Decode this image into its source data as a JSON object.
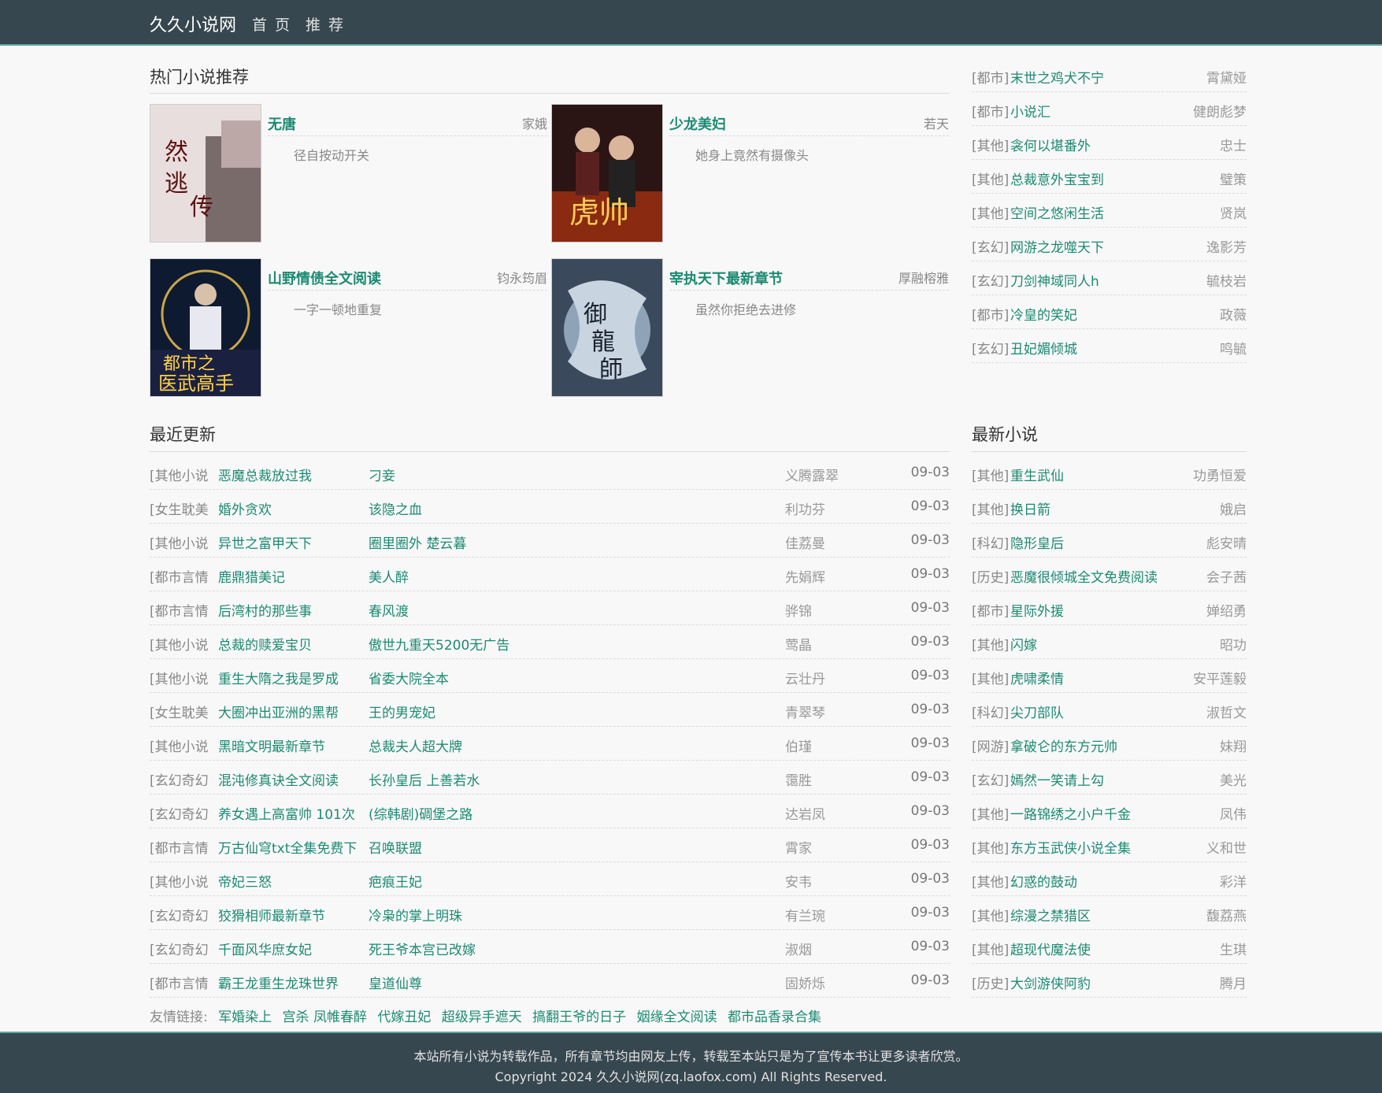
{
  "header": {
    "brand": "久久小说网",
    "nav": [
      "首 页",
      "推 荐"
    ]
  },
  "hot": {
    "title": "热门小说推荐",
    "books": [
      {
        "title": "无唐",
        "author": "家娥",
        "desc": "径自按动开关"
      },
      {
        "title": "少龙美妇",
        "author": "若天",
        "desc": "她身上竟然有摄像头"
      },
      {
        "title": "山野情债全文阅读",
        "author": "钧永筠眉",
        "desc": "一字一顿地重复"
      },
      {
        "title": "宰执天下最新章节",
        "author": "厚融榕雅",
        "desc": "虽然你拒绝去进修"
      }
    ]
  },
  "side_top": [
    {
      "cat": "[都市]",
      "title": "末世之鸡犬不宁",
      "author": "霄黛娅"
    },
    {
      "cat": "[都市]",
      "title": "小说汇",
      "author": "健朗彪梦"
    },
    {
      "cat": "[其他]",
      "title": "衾何以堪番外",
      "author": "忠士"
    },
    {
      "cat": "[其他]",
      "title": "总裁意外宝宝到",
      "author": "璧策"
    },
    {
      "cat": "[其他]",
      "title": "空间之悠闲生活",
      "author": "贤岚"
    },
    {
      "cat": "[玄幻]",
      "title": "网游之龙噬天下",
      "author": "逸影芳"
    },
    {
      "cat": "[玄幻]",
      "title": "刀剑神域同人h",
      "author": "毓枝岩"
    },
    {
      "cat": "[都市]",
      "title": "冷皇的笑妃",
      "author": "政薇"
    },
    {
      "cat": "[玄幻]",
      "title": "丑妃媚倾城",
      "author": "鸣毓"
    }
  ],
  "recent": {
    "title": "最近更新",
    "rows": [
      {
        "cat": "[其他小说",
        "title": "恶魔总裁放过我",
        "chapter": "刁妾",
        "author": "义腾露翠",
        "date": "09-03"
      },
      {
        "cat": "[女生耽美",
        "title": "婚外贪欢",
        "chapter": "该隐之血",
        "author": "利功芬",
        "date": "09-03"
      },
      {
        "cat": "[其他小说",
        "title": "异世之富甲天下",
        "chapter": "圈里圈外 楚云暮",
        "author": "佳荔曼",
        "date": "09-03"
      },
      {
        "cat": "[都市言情",
        "title": "鹿鼎猎美记",
        "chapter": "美人醉",
        "author": "先娟辉",
        "date": "09-03"
      },
      {
        "cat": "[都市言情",
        "title": "后湾村的那些事",
        "chapter": "春风渡",
        "author": "骅锦",
        "date": "09-03"
      },
      {
        "cat": "[其他小说",
        "title": "总裁的赎爱宝贝",
        "chapter": "傲世九重天5200无广告",
        "author": "莺晶",
        "date": "09-03"
      },
      {
        "cat": "[其他小说",
        "title": "重生大隋之我是罗成",
        "chapter": "省委大院全本",
        "author": "云壮丹",
        "date": "09-03"
      },
      {
        "cat": "[女生耽美",
        "title": "大圈冲出亚洲的黑帮",
        "chapter": "王的男宠妃",
        "author": "青翠琴",
        "date": "09-03"
      },
      {
        "cat": "[其他小说",
        "title": "黑暗文明最新章节",
        "chapter": "总裁夫人超大牌",
        "author": "伯瑾",
        "date": "09-03"
      },
      {
        "cat": "[玄幻奇幻",
        "title": "混沌修真诀全文阅读",
        "chapter": "长孙皇后 上善若水",
        "author": "霭胜",
        "date": "09-03"
      },
      {
        "cat": "[玄幻奇幻",
        "title": "养女遇上高富帅 101次",
        "chapter": "(综韩剧)碉堡之路",
        "author": "达岩凤",
        "date": "09-03"
      },
      {
        "cat": "[都市言情",
        "title": "万古仙穹txt全集免费下",
        "chapter": "召唤联盟",
        "author": "霄家",
        "date": "09-03"
      },
      {
        "cat": "[其他小说",
        "title": "帝妃三怒",
        "chapter": "疤痕王妃",
        "author": "安韦",
        "date": "09-03"
      },
      {
        "cat": "[玄幻奇幻",
        "title": "狡猾相师最新章节",
        "chapter": "冷枭的掌上明珠",
        "author": "有兰琬",
        "date": "09-03"
      },
      {
        "cat": "[玄幻奇幻",
        "title": "千面风华庶女妃",
        "chapter": "死王爷本宫已改嫁",
        "author": "淑烟",
        "date": "09-03"
      },
      {
        "cat": "[都市言情",
        "title": "霸王龙重生龙珠世界",
        "chapter": "皇道仙尊",
        "author": "固娇烁",
        "date": "09-03"
      }
    ]
  },
  "newest": {
    "title": "最新小说",
    "rows": [
      {
        "cat": "[其他]",
        "title": "重生武仙",
        "author": "功勇恒爱"
      },
      {
        "cat": "[其他]",
        "title": "换日箭",
        "author": "娥启"
      },
      {
        "cat": "[科幻]",
        "title": "隐形皇后",
        "author": "彪安晴"
      },
      {
        "cat": "[历史]",
        "title": "恶魔很倾城全文免费阅读",
        "author": "会子茜"
      },
      {
        "cat": "[都市]",
        "title": "星际外援",
        "author": "婵绍勇"
      },
      {
        "cat": "[其他]",
        "title": "闪嫁",
        "author": "昭功"
      },
      {
        "cat": "[其他]",
        "title": "虎啸柔情",
        "author": "安平莲毅"
      },
      {
        "cat": "[科幻]",
        "title": "尖刀部队",
        "author": "淑哲文"
      },
      {
        "cat": "[网游]",
        "title": "拿破仑的东方元帅",
        "author": "妹翔"
      },
      {
        "cat": "[玄幻]",
        "title": "嫣然一笑请上勾",
        "author": "美光"
      },
      {
        "cat": "[其他]",
        "title": "一路锦绣之小户千金",
        "author": "凤伟"
      },
      {
        "cat": "[其他]",
        "title": "东方玉武侠小说全集",
        "author": "义和世"
      },
      {
        "cat": "[其他]",
        "title": "幻惑的鼓动",
        "author": "彩洋"
      },
      {
        "cat": "[其他]",
        "title": "综漫之禁猎区",
        "author": "馥荔燕"
      },
      {
        "cat": "[其他]",
        "title": "超现代魔法使",
        "author": "生琪"
      },
      {
        "cat": "[历史]",
        "title": "大剑游侠阿豹",
        "author": "腾月"
      }
    ]
  },
  "friend_links": {
    "label": "友情链接:",
    "items": [
      "军婚染上",
      "宫杀 凤帷春醉",
      "代嫁丑妃",
      "超级异手遮天",
      "搞翻王爷的日子",
      "姻缘全文阅读",
      "都市品香录合集"
    ]
  },
  "footer": {
    "line1": "本站所有小说为转载作品，所有章节均由网友上传，转载至本站只是为了宣传本书让更多读者欣赏。",
    "line2": "Copyright 2024 久久小说网(zq.laofox.com) All Rights Reserved."
  }
}
